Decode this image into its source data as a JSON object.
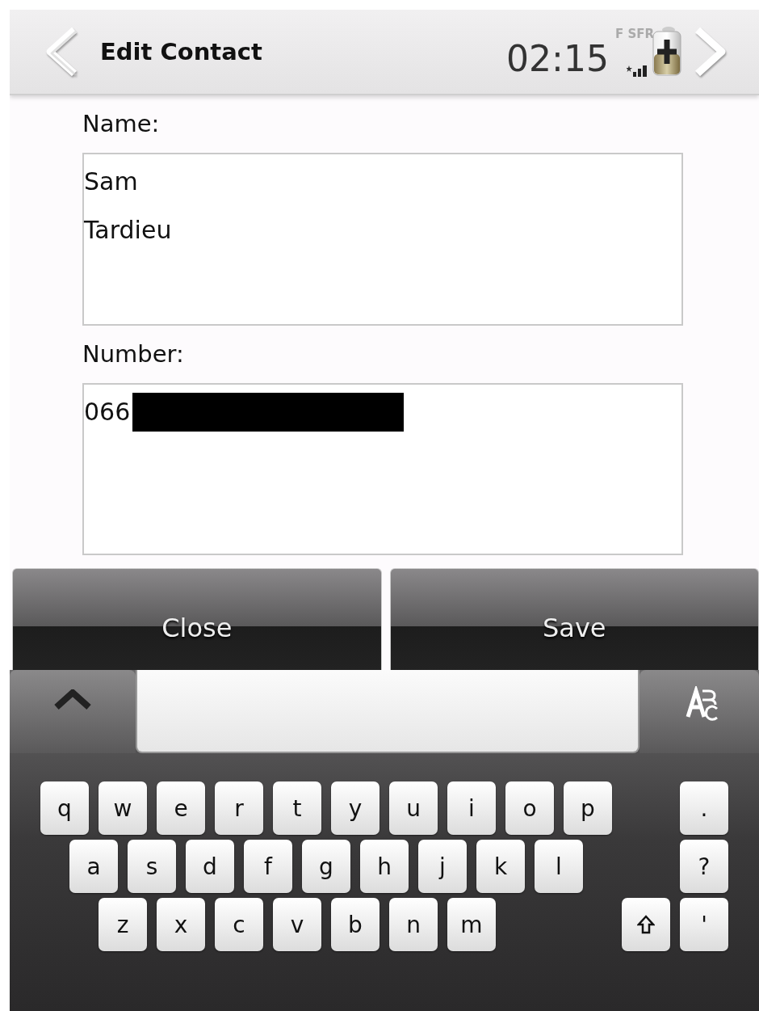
{
  "header": {
    "title": "Edit Contact",
    "time": "02:15",
    "operator": "F SFR"
  },
  "form": [
    {
      "label": "Name:",
      "lines": [
        "Sam",
        "Tardieu"
      ],
      "redacted": false
    },
    {
      "label": "Number:",
      "lines": [
        "066"
      ],
      "redacted": true
    }
  ],
  "buttons": [
    {
      "label": "Close"
    },
    {
      "label": "Save"
    }
  ],
  "keyboard": {
    "rows": [
      {
        "keys": [
          {
            "kind": "char",
            "label": "q"
          },
          {
            "kind": "char",
            "label": "w"
          },
          {
            "kind": "char",
            "label": "e"
          },
          {
            "kind": "char",
            "label": "r"
          },
          {
            "kind": "char",
            "label": "t"
          },
          {
            "kind": "char",
            "label": "y"
          },
          {
            "kind": "char",
            "label": "u"
          },
          {
            "kind": "char",
            "label": "i"
          },
          {
            "kind": "char",
            "label": "o"
          },
          {
            "kind": "char",
            "label": "p"
          }
        ],
        "side": [
          {
            "kind": "char",
            "label": "."
          }
        ]
      },
      {
        "keys": [
          {
            "kind": "char",
            "label": "a"
          },
          {
            "kind": "char",
            "label": "s"
          },
          {
            "kind": "char",
            "label": "d"
          },
          {
            "kind": "char",
            "label": "f"
          },
          {
            "kind": "char",
            "label": "g"
          },
          {
            "kind": "char",
            "label": "h"
          },
          {
            "kind": "char",
            "label": "j"
          },
          {
            "kind": "char",
            "label": "k"
          },
          {
            "kind": "char",
            "label": "l"
          }
        ],
        "side": [
          {
            "kind": "char",
            "label": "?"
          }
        ]
      },
      {
        "keys": [
          {
            "kind": "char",
            "label": "z"
          },
          {
            "kind": "char",
            "label": "x"
          },
          {
            "kind": "char",
            "label": "c"
          },
          {
            "kind": "char",
            "label": "v"
          },
          {
            "kind": "char",
            "label": "b"
          },
          {
            "kind": "char",
            "label": "n"
          },
          {
            "kind": "char",
            "label": "m"
          }
        ],
        "side": [
          {
            "kind": "shift"
          },
          {
            "kind": "char",
            "label": "'"
          }
        ]
      }
    ]
  }
}
